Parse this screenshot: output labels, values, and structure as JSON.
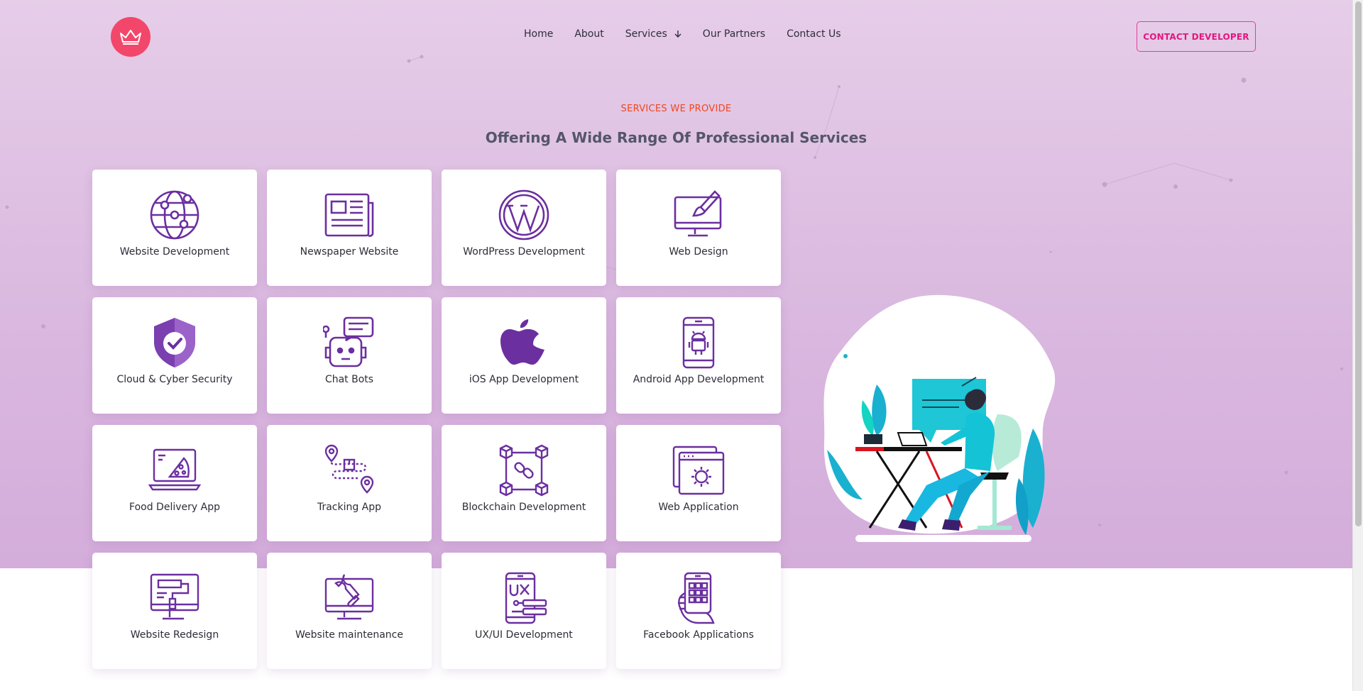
{
  "colors": {
    "accent_pink": "#e1187f",
    "accent_orange": "#f0461f",
    "logo_red": "#f2476a",
    "icon_purple": "#6b2fa0",
    "hero_bg": "#dcbde2"
  },
  "header": {
    "logo_icon": "crown-icon",
    "nav": [
      {
        "label": "Home"
      },
      {
        "label": "About"
      },
      {
        "label": "Services",
        "icon": "arrow-down-icon"
      },
      {
        "label": "Our Partners"
      },
      {
        "label": "Contact Us"
      }
    ],
    "contact_button": "CONTACT DEVELOPER"
  },
  "services": {
    "kicker": "SERVICES WE PROVIDE",
    "title": "Offering A Wide Range Of Professional Services",
    "items": [
      {
        "label": "Website Development",
        "icon": "globe-network-icon"
      },
      {
        "label": "Newspaper Website",
        "icon": "newspaper-icon"
      },
      {
        "label": "WordPress Development",
        "icon": "wordpress-icon"
      },
      {
        "label": "Web Design",
        "icon": "monitor-brush-icon"
      },
      {
        "label": "Cloud & Cyber Security",
        "icon": "shield-check-icon"
      },
      {
        "label": "Chat Bots",
        "icon": "robot-chat-icon"
      },
      {
        "label": "iOS App Development",
        "icon": "apple-icon"
      },
      {
        "label": "Android App Development",
        "icon": "android-phone-icon"
      },
      {
        "label": "Food Delivery App",
        "icon": "laptop-pizza-icon"
      },
      {
        "label": "Tracking App",
        "icon": "route-pin-icon"
      },
      {
        "label": "Blockchain Development",
        "icon": "blockchain-icon"
      },
      {
        "label": "Web Application",
        "icon": "browser-gear-icon"
      },
      {
        "label": "Website Redesign",
        "icon": "monitor-roller-icon"
      },
      {
        "label": "Website maintenance",
        "icon": "monitor-wrench-icon"
      },
      {
        "label": "UX/UI Development",
        "icon": "phone-ux-icon"
      },
      {
        "label": "Facebook Applications",
        "icon": "hand-phone-apps-icon"
      }
    ]
  },
  "illustration": {
    "icon": "developer-at-desk-illustration"
  }
}
